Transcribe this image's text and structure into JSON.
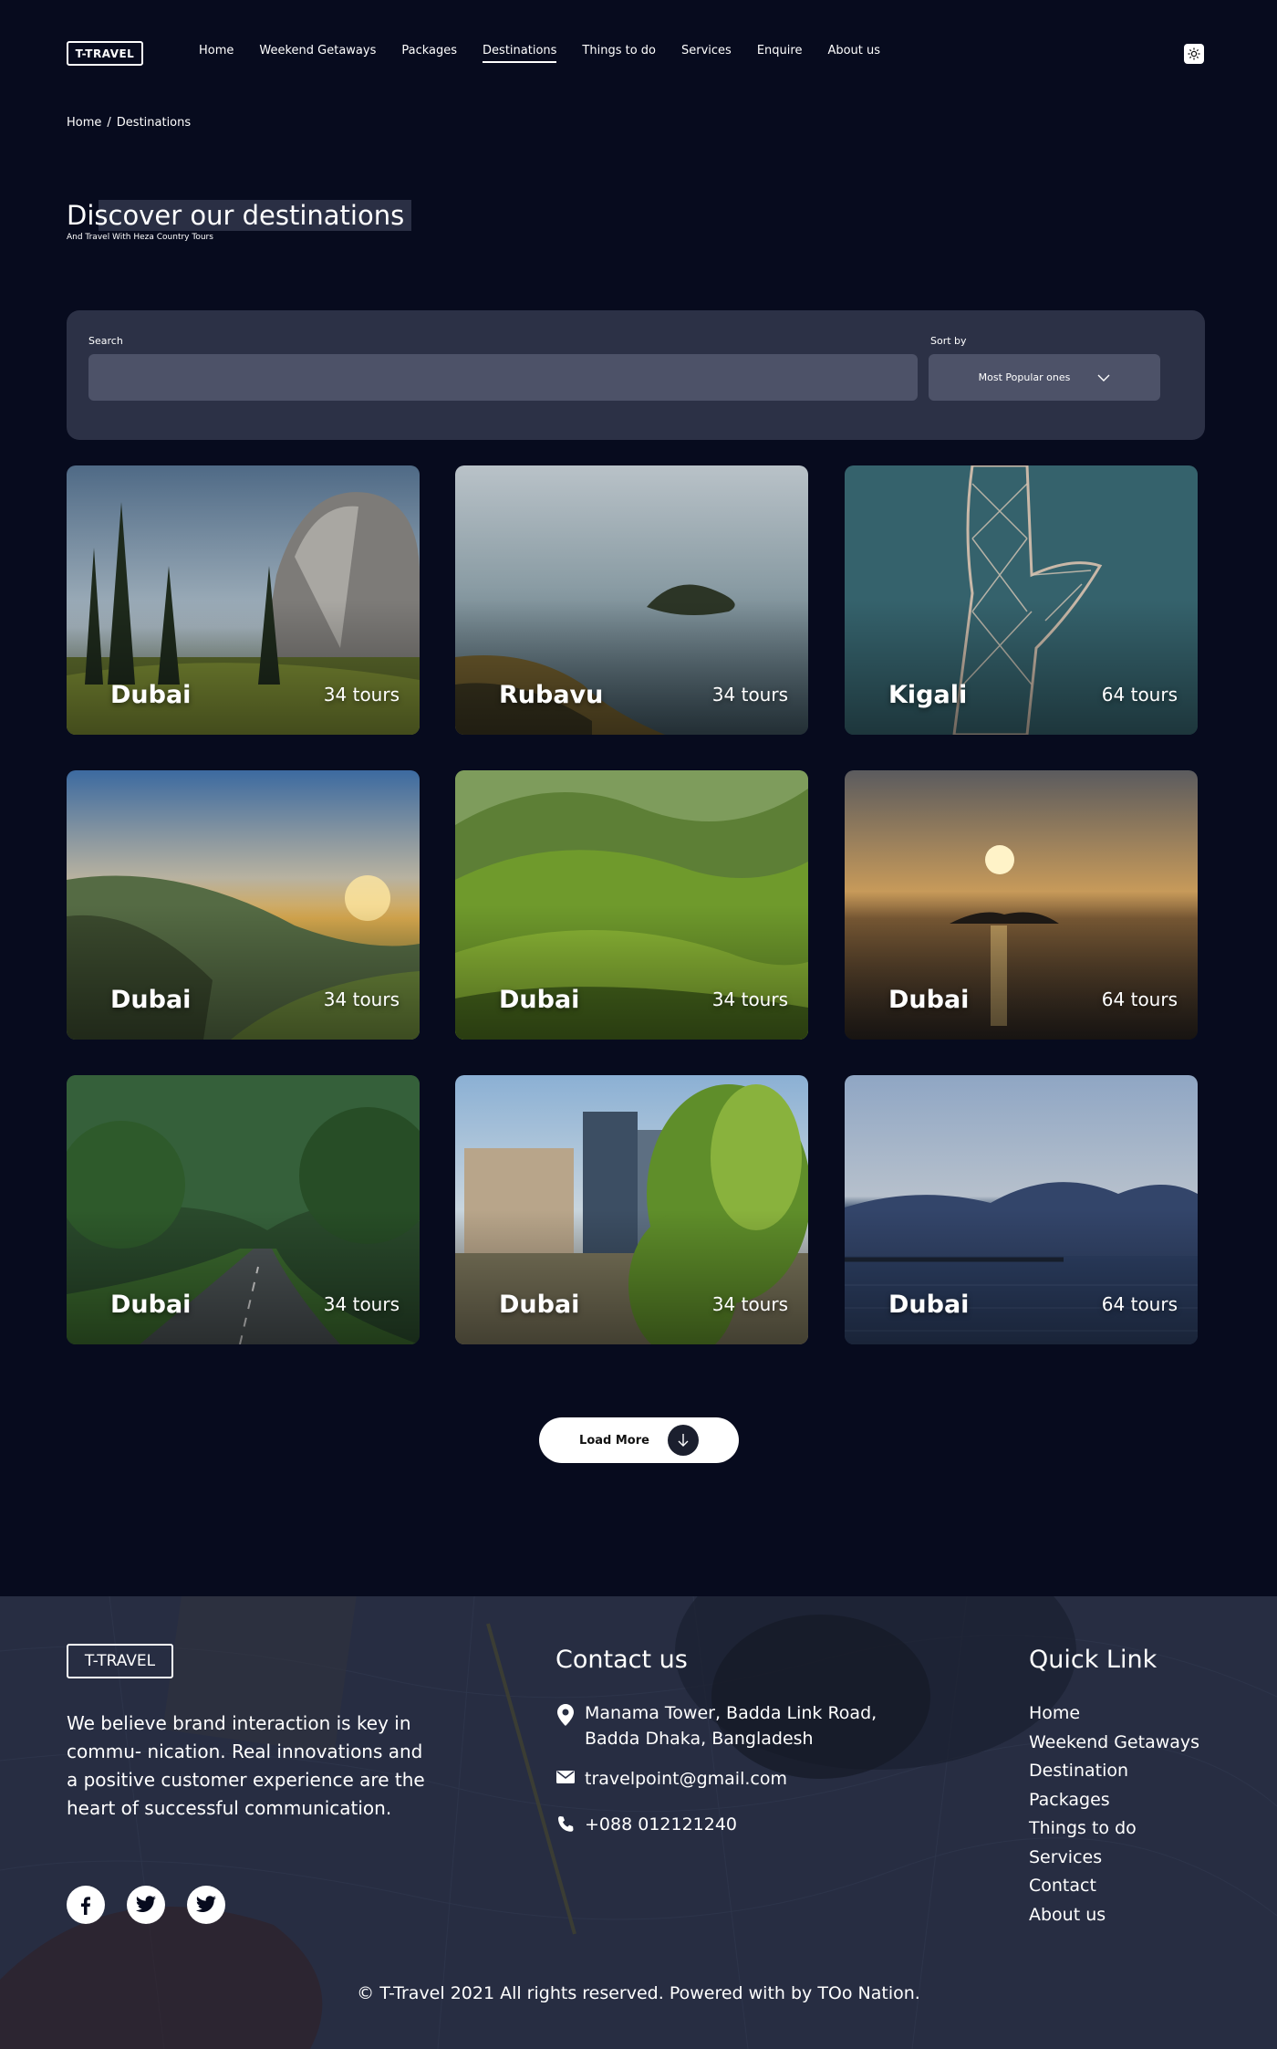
{
  "nav": {
    "logo": "T-TRAVEL",
    "items": [
      {
        "label": "Home"
      },
      {
        "label": "Weekend Getaways"
      },
      {
        "label": "Packages"
      },
      {
        "label": "Destinations"
      },
      {
        "label": "Things to do"
      },
      {
        "label": "Services"
      },
      {
        "label": "Enquire"
      },
      {
        "label": "About us"
      }
    ],
    "active": "Destinations"
  },
  "breadcrumb": {
    "home": "Home",
    "sep": "/",
    "current": "Destinations"
  },
  "hero": {
    "title": "Discover our destinations",
    "subtitle": "And Travel With Heza Country Tours"
  },
  "search": {
    "label": "Search",
    "placeholder": "",
    "value": ""
  },
  "sort": {
    "label": "Sort by",
    "selected": "Most Popular ones"
  },
  "destinations": [
    {
      "name": "Dubai",
      "tours": "34 tours",
      "scene": "mountain"
    },
    {
      "name": "Rubavu",
      "tours": "34 tours",
      "scene": "lake-island"
    },
    {
      "name": "Kigali",
      "tours": "64 tours",
      "scene": "sculpture"
    },
    {
      "name": "Dubai",
      "tours": "34 tours",
      "scene": "valley-sunset"
    },
    {
      "name": "Dubai",
      "tours": "34 tours",
      "scene": "green-hills"
    },
    {
      "name": "Dubai",
      "tours": "64 tours",
      "scene": "sunset-sea"
    },
    {
      "name": "Dubai",
      "tours": "34 tours",
      "scene": "forest-road"
    },
    {
      "name": "Dubai",
      "tours": "34 tours",
      "scene": "city-plants"
    },
    {
      "name": "Dubai",
      "tours": "64 tours",
      "scene": "lake-mountains"
    }
  ],
  "load_more": "Load More",
  "footer": {
    "logo": "T-TRAVEL",
    "about": "We believe brand interaction is key in commu- nication. Real innovations and a positive customer experience are the heart of successful communication.",
    "socials": [
      "facebook-icon",
      "twitter-icon",
      "twitter-icon"
    ],
    "contact_title": "Contact us",
    "address": "Manama Tower, Badda Link Road, Badda Dhaka, Bangladesh",
    "email": "travelpoint@gmail.com",
    "phone": "+088 012121240",
    "quick_title": "Quick Link",
    "quick_links": [
      "Home",
      "Weekend Getaways",
      "Destination",
      "Packages",
      "Things to do",
      "Services",
      "Contact",
      "About us"
    ],
    "copyright": "© T-Travel 2021 All rights reserved. Powered with  by TOo Nation."
  },
  "colors": {
    "background": "#070b1e",
    "panel": "#2c3146",
    "input": "#4d5268",
    "text": "#ffffff"
  }
}
